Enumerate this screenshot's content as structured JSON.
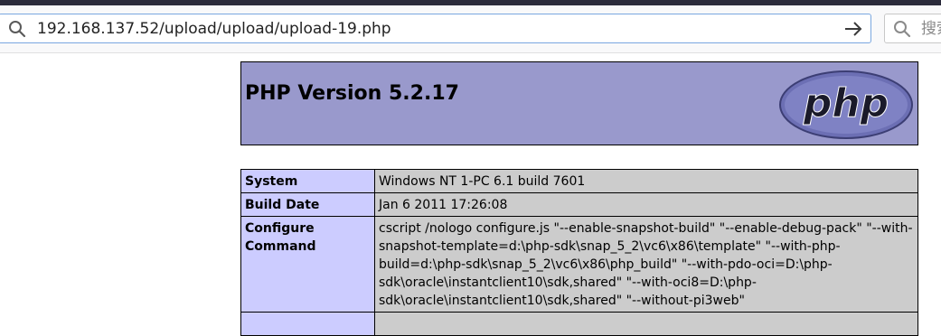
{
  "browser": {
    "url": "192.168.137.52/upload/upload/upload-19.php",
    "search_placeholder": "搜索",
    "icons": {
      "url_left": "search-icon",
      "url_right": "go-arrow-icon",
      "searchbox": "search-icon"
    }
  },
  "page": {
    "title": "PHP Version 5.2.17",
    "logo_text": "php",
    "colors": {
      "header_bg": "#9999cc",
      "label_bg": "#ccccff",
      "value_bg": "#cccccc"
    },
    "rows": [
      {
        "label": "System",
        "value": "Windows NT 1-PC 6.1 build 7601"
      },
      {
        "label": "Build Date",
        "value": "Jan 6 2011 17:26:08"
      },
      {
        "label": "Configure Command",
        "value": "cscript /nologo configure.js \"--enable-snapshot-build\" \"--enable-debug-pack\" \"--with-snapshot-template=d:\\php-sdk\\snap_5_2\\vc6\\x86\\template\" \"--with-php-build=d:\\php-sdk\\snap_5_2\\vc6\\x86\\php_build\" \"--with-pdo-oci=D:\\php-sdk\\oracle\\instantclient10\\sdk,shared\" \"--with-oci8=D:\\php-sdk\\oracle\\instantclient10\\sdk,shared\" \"--without-pi3web\""
      }
    ]
  }
}
